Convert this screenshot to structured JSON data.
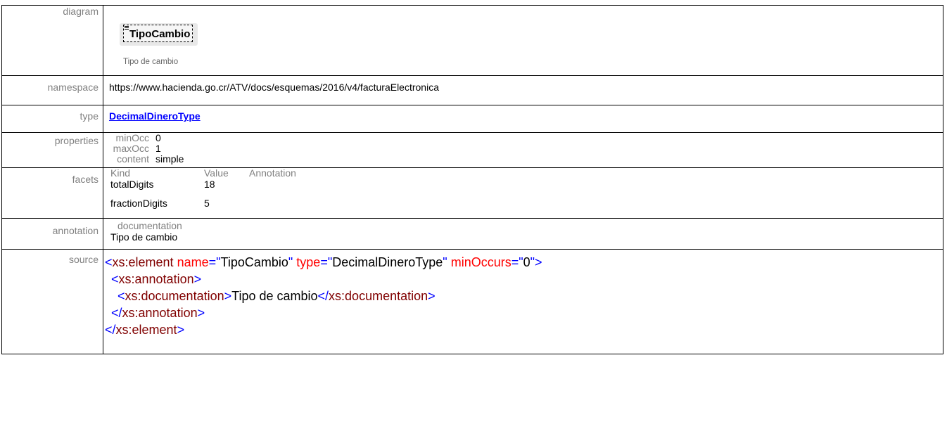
{
  "labels": {
    "diagram": "diagram",
    "namespace": "namespace",
    "type": "type",
    "properties": "properties",
    "facets": "facets",
    "annotation": "annotation",
    "source": "source"
  },
  "diagram": {
    "element_name": "TipoCambio",
    "documentation": "Tipo de cambio"
  },
  "namespace": "https://www.hacienda.go.cr/ATV/docs/esquemas/2016/v4/facturaElectronica",
  "type": "DecimalDineroType",
  "properties": [
    {
      "key": "minOcc",
      "value": "0"
    },
    {
      "key": "maxOcc",
      "value": "1"
    },
    {
      "key": "content",
      "value": "simple"
    }
  ],
  "facets": {
    "headers": [
      "Kind",
      "Value",
      "Annotation"
    ],
    "rows": [
      {
        "kind": "totalDigits",
        "value": "18",
        "annotation": ""
      },
      {
        "kind": "fractionDigits",
        "value": "5",
        "annotation": ""
      }
    ]
  },
  "annotation": {
    "title": "documentation",
    "text": "Tipo de cambio"
  },
  "source": {
    "element_tag": "xs:element",
    "attr_name": "name",
    "attr_name_value": "TipoCambio",
    "attr_type": "type",
    "attr_type_value": "DecimalDineroType",
    "attr_min": "minOccurs",
    "attr_min_value": "0",
    "annotation_tag": "xs:annotation",
    "documentation_tag": "xs:documentation",
    "documentation_text": "Tipo de cambio"
  },
  "colors": {
    "label": "#808080",
    "link": "#0000ff",
    "xml_bracket": "#0000ff",
    "xml_tag": "#800000",
    "xml_attr": "#ff0000"
  }
}
